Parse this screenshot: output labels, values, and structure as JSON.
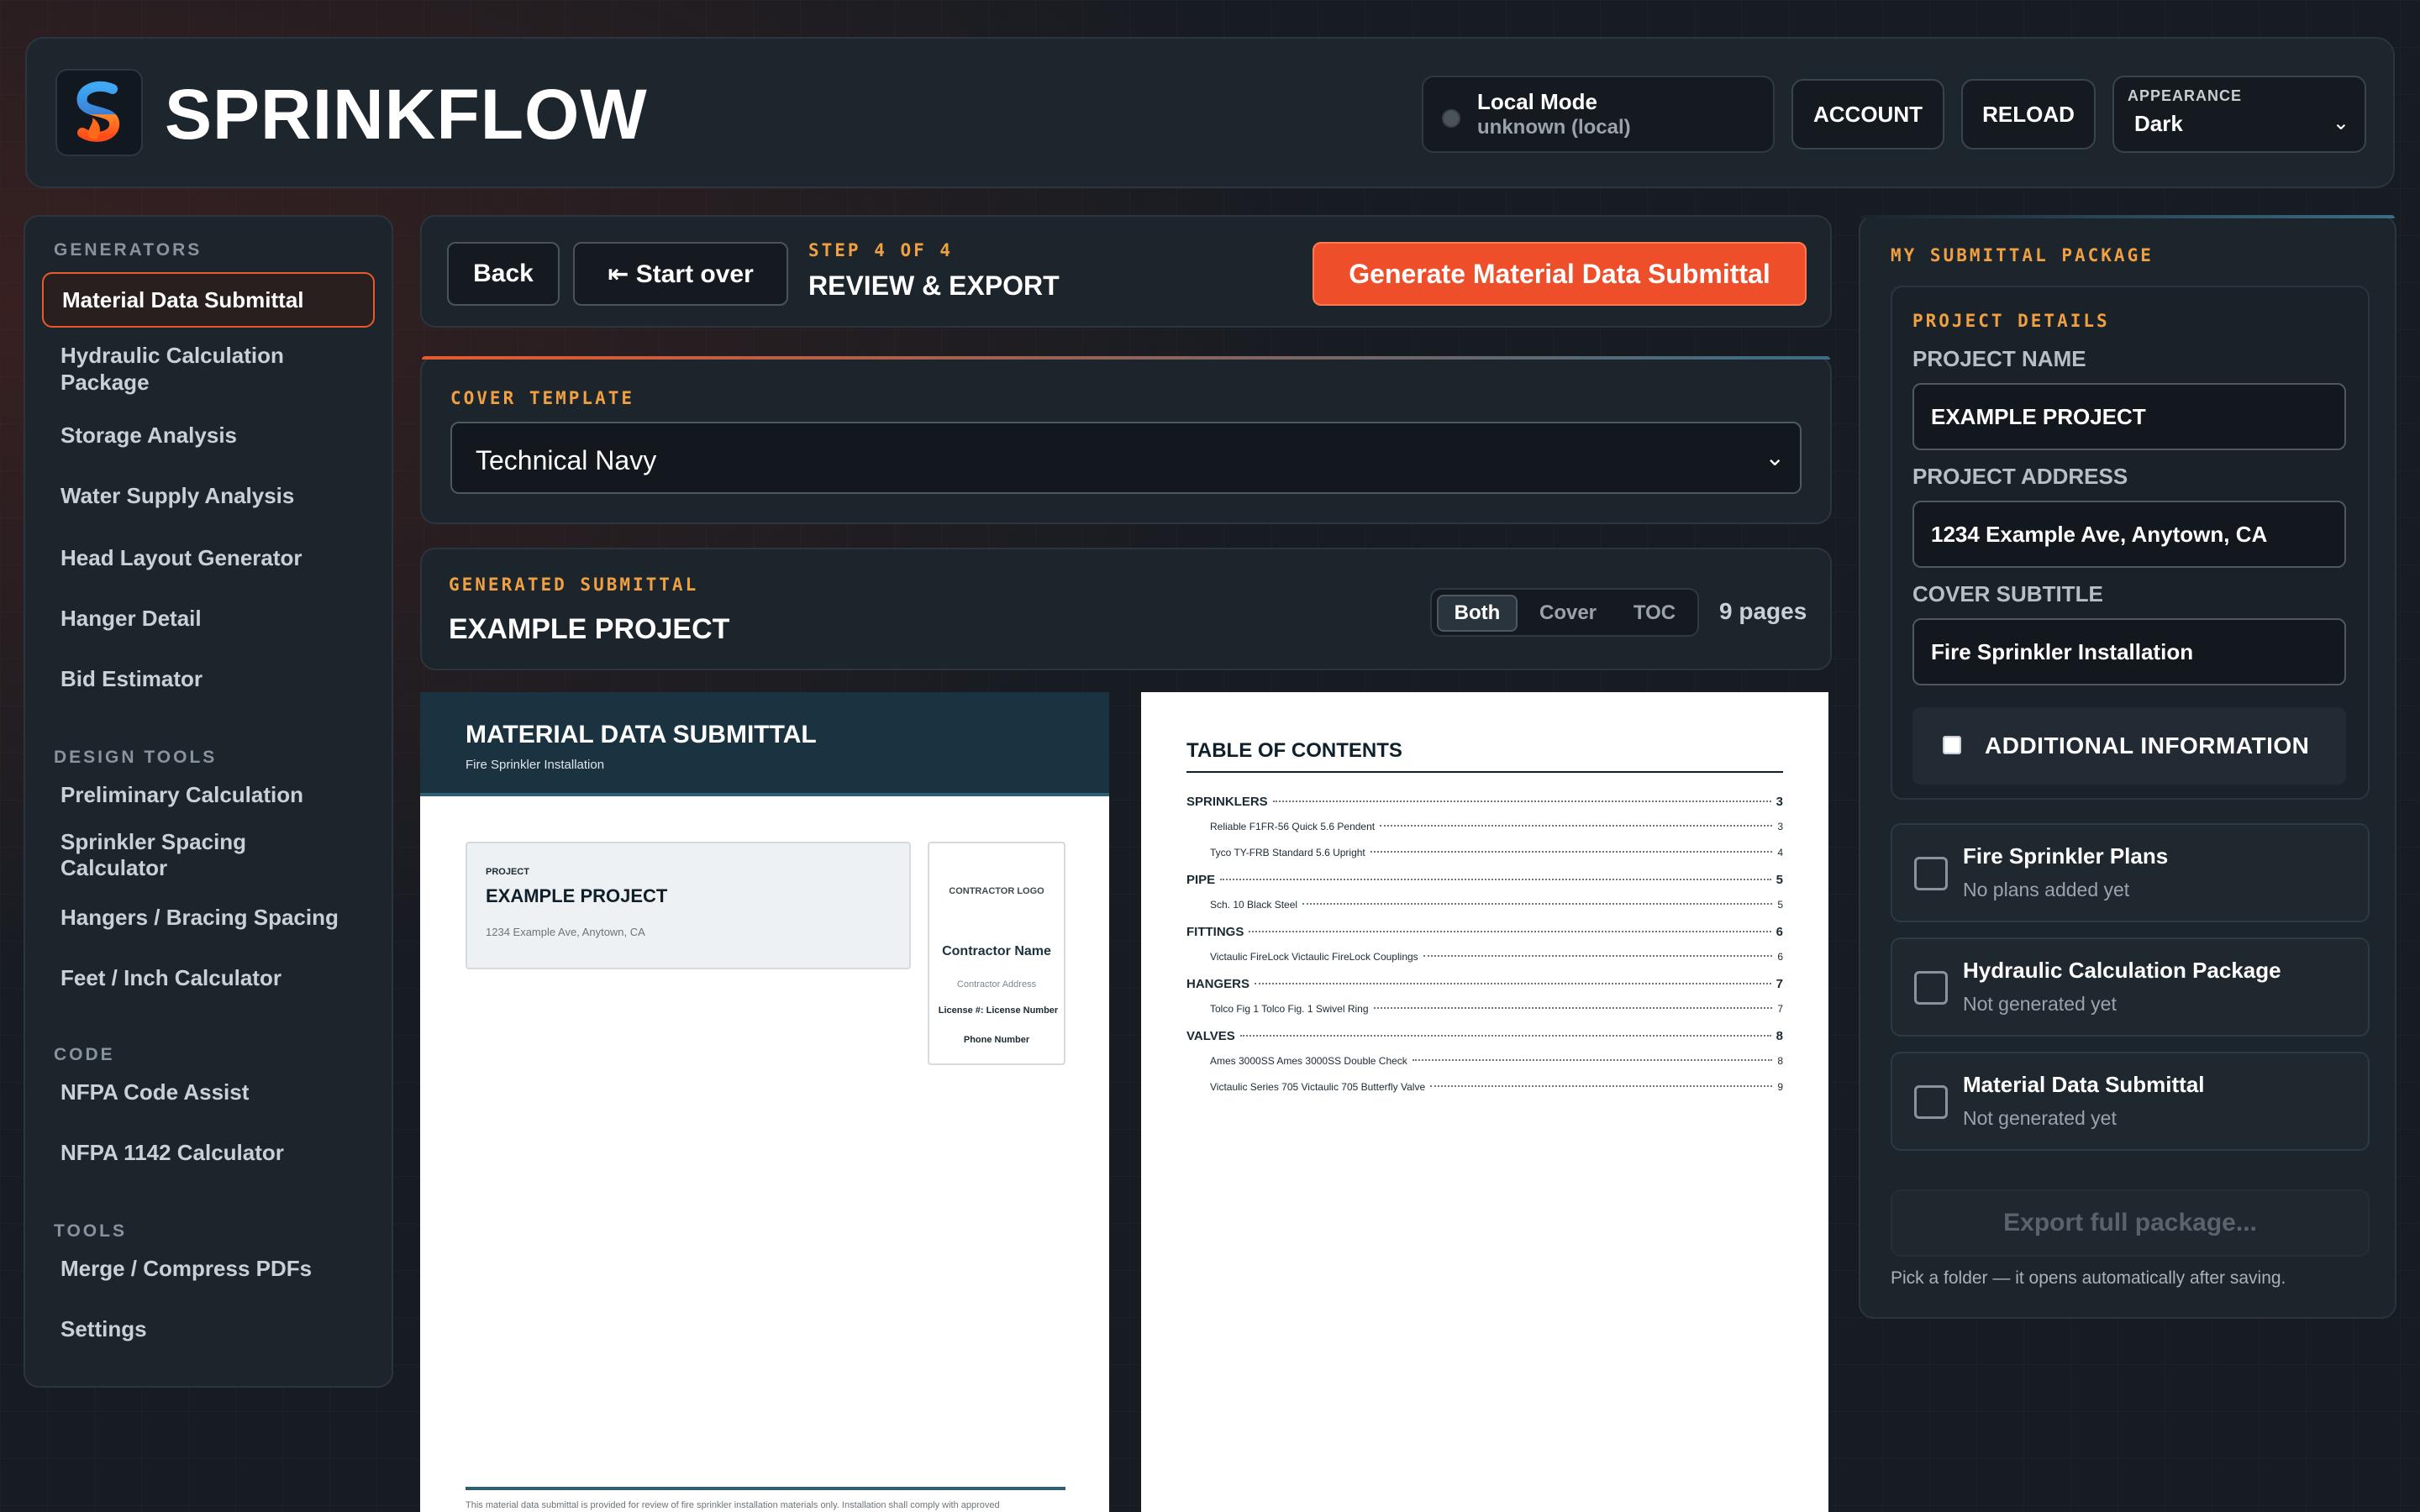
{
  "header": {
    "app_title": "SPRINKFLOW",
    "mode_title": "Local Mode",
    "mode_sub": "unknown (local)",
    "account_label": "ACCOUNT",
    "reload_label": "RELOAD",
    "appearance_label": "APPEARANCE",
    "appearance_value": "Dark"
  },
  "sidebar": {
    "sections": [
      {
        "label": "GENERATORS"
      },
      {
        "label": "DESIGN TOOLS"
      },
      {
        "label": "CODE"
      },
      {
        "label": "TOOLS"
      }
    ],
    "items": [
      {
        "label": "Material Data Submittal"
      },
      {
        "label": "Hydraulic Calculation Package"
      },
      {
        "label": "Storage Analysis"
      },
      {
        "label": "Water Supply Analysis"
      },
      {
        "label": "Head Layout Generator"
      },
      {
        "label": "Hanger Detail"
      },
      {
        "label": "Bid Estimator"
      },
      {
        "label": "Preliminary Calculation"
      },
      {
        "label": "Sprinkler Spacing Calculator"
      },
      {
        "label": "Hangers / Bracing Spacing"
      },
      {
        "label": "Feet / Inch Calculator"
      },
      {
        "label": "NFPA Code Assist"
      },
      {
        "label": "NFPA 1142 Calculator"
      },
      {
        "label": "Merge / Compress PDFs"
      },
      {
        "label": "Settings"
      }
    ]
  },
  "step": {
    "back_label": "Back",
    "start_over_label": "⇤ Start over",
    "step_label": "STEP 4 OF 4",
    "step_title": "REVIEW & EXPORT",
    "generate_label": "Generate Material Data Submittal"
  },
  "cover_template": {
    "label": "COVER TEMPLATE",
    "value": "Technical Navy"
  },
  "generated": {
    "label": "GENERATED SUBMITTAL",
    "title": "EXAMPLE PROJECT",
    "seg": [
      "Both",
      "Cover",
      "TOC"
    ],
    "pages": "9 pages"
  },
  "cover_preview": {
    "title": "MATERIAL DATA SUBMITTAL",
    "subtitle": "Fire Sprinkler Installation",
    "project_label": "PROJECT",
    "project_name": "EXAMPLE PROJECT",
    "project_address": "1234 Example Ave, Anytown, CA",
    "contractor_logo": "CONTRACTOR LOGO",
    "contractor_name": "Contractor Name",
    "contractor_address": "Contractor Address",
    "contractor_license": "License #: License Number",
    "contractor_phone": "Phone Number",
    "disclaimer": "This material data submittal is provided for review of fire sprinkler installation materials only. Installation shall comply with approved"
  },
  "toc": {
    "title": "TABLE OF CONTENTS",
    "rows": [
      {
        "text": "SPRINKLERS",
        "page": "3",
        "kind": "section"
      },
      {
        "text": "Reliable F1FR-56 Quick 5.6 Pendent",
        "page": "3",
        "kind": "entry"
      },
      {
        "text": "Tyco TY-FRB Standard 5.6 Upright",
        "page": "4",
        "kind": "entry"
      },
      {
        "text": "PIPE",
        "page": "5",
        "kind": "section"
      },
      {
        "text": "Sch. 10 Black Steel",
        "page": "5",
        "kind": "entry"
      },
      {
        "text": "FITTINGS",
        "page": "6",
        "kind": "section"
      },
      {
        "text": "Victaulic FireLock Victaulic FireLock Couplings",
        "page": "6",
        "kind": "entry"
      },
      {
        "text": "HANGERS",
        "page": "7",
        "kind": "section"
      },
      {
        "text": "Tolco Fig 1 Tolco Fig. 1 Swivel Ring",
        "page": "7",
        "kind": "entry"
      },
      {
        "text": "VALVES",
        "page": "8",
        "kind": "section"
      },
      {
        "text": "Ames 3000SS Ames 3000SS Double Check",
        "page": "8",
        "kind": "entry"
      },
      {
        "text": "Victaulic Series 705 Victaulic 705 Butterfly Valve",
        "page": "9",
        "kind": "entry"
      }
    ]
  },
  "package": {
    "label": "MY SUBMITTAL PACKAGE",
    "details_label": "PROJECT DETAILS",
    "project_name_label": "PROJECT NAME",
    "project_name_value": "EXAMPLE PROJECT",
    "project_address_label": "PROJECT ADDRESS",
    "project_address_value": "1234 Example Ave, Anytown, CA",
    "cover_subtitle_label": "COVER SUBTITLE",
    "cover_subtitle_value": "Fire Sprinkler Installation",
    "additional_label": "ADDITIONAL INFORMATION",
    "items": [
      {
        "title": "Fire Sprinkler Plans",
        "sub": "No plans added yet"
      },
      {
        "title": "Hydraulic Calculation Package",
        "sub": "Not generated yet"
      },
      {
        "title": "Material Data Submittal",
        "sub": "Not generated yet"
      }
    ],
    "export_label": "Export full package...",
    "export_hint": "Pick a folder — it opens automatically after saving."
  },
  "colors": {
    "accent": "#ee4f2a",
    "label_accent": "#f0a040",
    "cover_header": "#1b3340"
  }
}
